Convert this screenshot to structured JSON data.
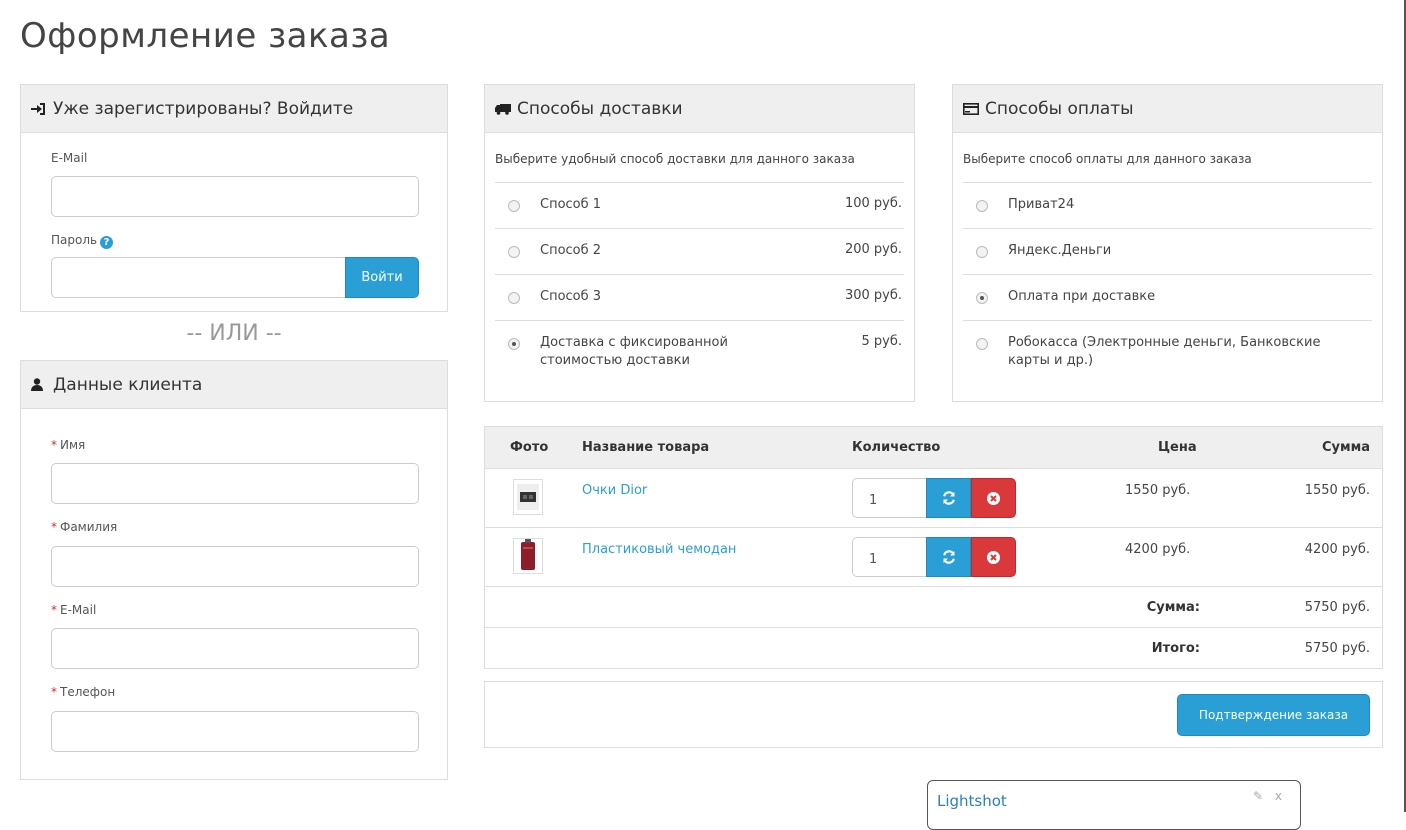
{
  "page_title": "Оформление заказа",
  "login": {
    "heading": "Уже зарегистрированы? Войдите",
    "email_label": "E-Mail",
    "password_label": "Пароль",
    "login_button": "Войти"
  },
  "or_text": "-- ИЛИ --",
  "customer": {
    "heading": "Данные клиента",
    "required_mark": "*",
    "first_name_label": "Имя",
    "last_name_label": "Фамилия",
    "email_label": "E-Mail",
    "phone_label": "Телефон"
  },
  "delivery": {
    "heading": "Способы доставки",
    "description": "Выберите удобный способ доставки для данного заказа",
    "options": [
      {
        "label": "Способ 1",
        "price": "100 руб.",
        "selected": false
      },
      {
        "label": "Способ 2",
        "price": "200 руб.",
        "selected": false
      },
      {
        "label": "Способ 3",
        "price": "300 руб.",
        "selected": false
      },
      {
        "label": "Доставка с фиксированной стоимостью доставки",
        "price": "5 руб.",
        "selected": true
      }
    ]
  },
  "payment": {
    "heading": "Способы оплаты",
    "description": "Выберите способ оплаты для данного заказа",
    "options": [
      {
        "label": "Приват24",
        "selected": false
      },
      {
        "label": "Яндекс.Деньги",
        "selected": false
      },
      {
        "label": "Оплата при доставке",
        "selected": true
      },
      {
        "label": "Робокасса (Электронные деньги, Банковские карты и др.)",
        "selected": false
      }
    ]
  },
  "cart": {
    "headers": {
      "photo": "Фото",
      "name": "Название товара",
      "quantity": "Количество",
      "price": "Цена",
      "sum": "Сумма"
    },
    "items": [
      {
        "name": "Очки Dior",
        "quantity": "1",
        "price": "1550 руб.",
        "sum": "1550 руб."
      },
      {
        "name": "Пластиковый чемодан",
        "quantity": "1",
        "price": "4200 руб.",
        "sum": "4200 руб."
      }
    ],
    "subtotal_label": "Сумма:",
    "subtotal_value": "5750 руб.",
    "total_label": "Итого:",
    "total_value": "5750 руб."
  },
  "confirm_button": "Подтверждение заказа",
  "lightshot": {
    "title": "Lightshot",
    "tools": "✎ x"
  },
  "colors": {
    "accent": "#2a9fd6",
    "danger": "#d9393b",
    "panel_heading_bg": "#efefef",
    "border": "#dddddd"
  }
}
